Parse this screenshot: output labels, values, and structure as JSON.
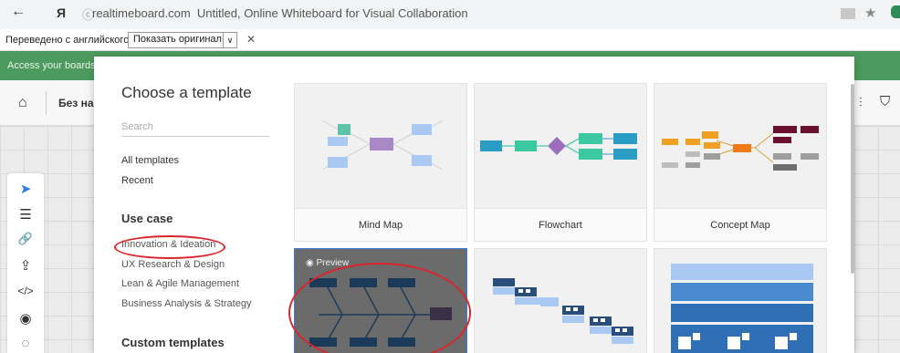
{
  "browser": {
    "back_glyph": "←",
    "ya_glyph": "Я",
    "separator": "ⓒ",
    "url": "realtimeboard.com",
    "tab_title": "Untitled, Online Whiteboard for Visual Collaboration",
    "star_glyph": "★"
  },
  "translate": {
    "text": "Переведено с английского",
    "show_original": "Показать оригинал",
    "dropdown_glyph": "∨",
    "close_glyph": "✕"
  },
  "banner": {
    "text": "Access your boards"
  },
  "app_toolbar": {
    "board_name": "Без наз",
    "home_glyph": "⌂",
    "right_icon_1": "⫶",
    "right_icon_2": "⛉"
  },
  "left_tools": [
    {
      "name": "select-arrow-icon",
      "glyph": "➤"
    },
    {
      "name": "frame-icon",
      "glyph": "☰"
    },
    {
      "name": "link-icon",
      "glyph": "🔗"
    },
    {
      "name": "upload-icon",
      "glyph": "⇪"
    },
    {
      "name": "embed-code-icon",
      "glyph": "</>"
    },
    {
      "name": "eye-icon",
      "glyph": "◉"
    },
    {
      "name": "comment-icon",
      "glyph": "◌"
    }
  ],
  "modal": {
    "title": "Choose a template",
    "search_placeholder": "Search",
    "all_templates": "All templates",
    "recent": "Recent",
    "use_case_heading": "Use case",
    "use_cases": [
      "Innovation & Ideation",
      "UX Research & Design",
      "Lean & Agile Management",
      "Business Analysis & Strategy"
    ],
    "custom_heading": "Custom templates",
    "cards": [
      {
        "label": "Mind Map"
      },
      {
        "label": "Flowchart"
      },
      {
        "label": "Concept Map"
      }
    ],
    "preview_label": "Preview"
  },
  "colors": {
    "teal": "#2b9cc4",
    "green": "#3cc9a2",
    "purple": "#9b6dbb",
    "orange": "#f0a020",
    "maroon": "#6b1030",
    "navy": "#1b3a5a",
    "highlight_red": "#d9262b"
  }
}
